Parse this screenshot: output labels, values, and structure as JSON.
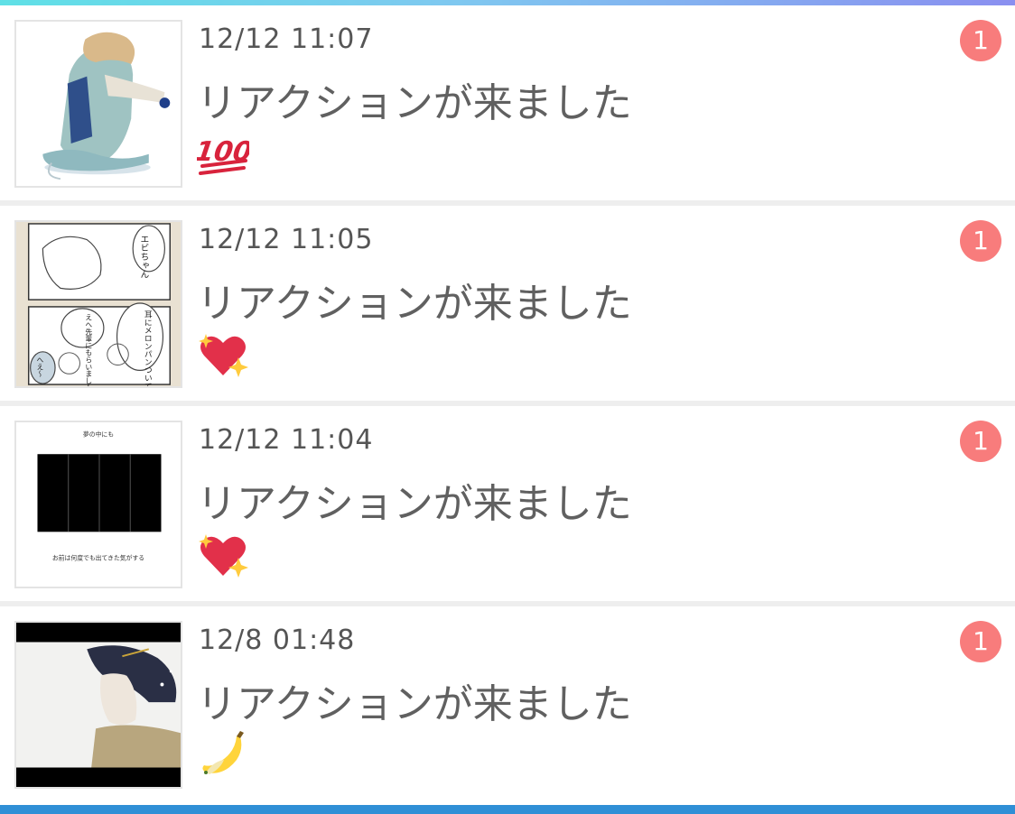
{
  "notifications": [
    {
      "time": "12/12 11:07",
      "title": "リアクションが来ました",
      "reaction": "hundred-points-icon",
      "badge": "1"
    },
    {
      "time": "12/12 11:05",
      "title": "リアクションが来ました",
      "reaction": "sparkling-heart-icon",
      "badge": "1"
    },
    {
      "time": "12/12 11:04",
      "title": "リアクションが来ました",
      "reaction": "sparkling-heart-icon",
      "badge": "1"
    },
    {
      "time": "12/8 01:48",
      "title": "リアクションが来ました",
      "reaction": "banana-icon",
      "badge": "1"
    }
  ],
  "thumbnail_texts": {
    "comic_bubble_1": "エビちゃん",
    "comic_bubble_2": "耳にメロンパンついてんね",
    "comic_bubble_3": "えへ先輩にもらいました",
    "comic_bubble_4": "へえ～",
    "page_title": "夢の中にも",
    "page_caption": "お前は何度でも出てきた気がする"
  },
  "colors": {
    "accent_top_left": "#5fe0e6",
    "accent_top_right": "#8a8ff0",
    "bottom_bar": "#2f8fd6",
    "badge": "#f87c7c"
  }
}
